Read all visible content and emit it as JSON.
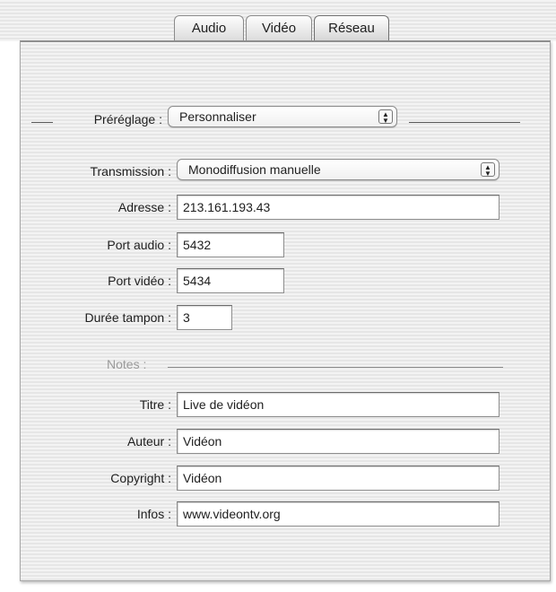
{
  "tabs": [
    {
      "label": "Audio",
      "active": false
    },
    {
      "label": "Vidéo",
      "active": false
    },
    {
      "label": "Réseau",
      "active": true
    }
  ],
  "preset": {
    "label": "Préréglage :",
    "value": "Personnaliser"
  },
  "transmission": {
    "label": "Transmission :",
    "value": "Monodiffusion manuelle"
  },
  "address": {
    "label": "Adresse :",
    "value": "213.161.193.43"
  },
  "audio_port": {
    "label": "Port audio :",
    "value": "5432"
  },
  "video_port": {
    "label": "Port vidéo :",
    "value": "5434"
  },
  "buffer": {
    "label": "Durée tampon :",
    "value": "3"
  },
  "notes": {
    "label": "Notes :",
    "title": {
      "label": "Titre :",
      "value": "Live de vidéon"
    },
    "author": {
      "label": "Auteur :",
      "value": "Vidéon"
    },
    "copyright": {
      "label": "Copyright :",
      "value": "Vidéon"
    },
    "info": {
      "label": "Infos :",
      "value": "www.videontv.org"
    }
  },
  "icons": {
    "popup_arrows": "up-down-arrows-icon"
  },
  "colors": {
    "panel_border": "#8f8f8f",
    "text": "#1e1e1e",
    "muted_label": "#9a9a9a"
  }
}
